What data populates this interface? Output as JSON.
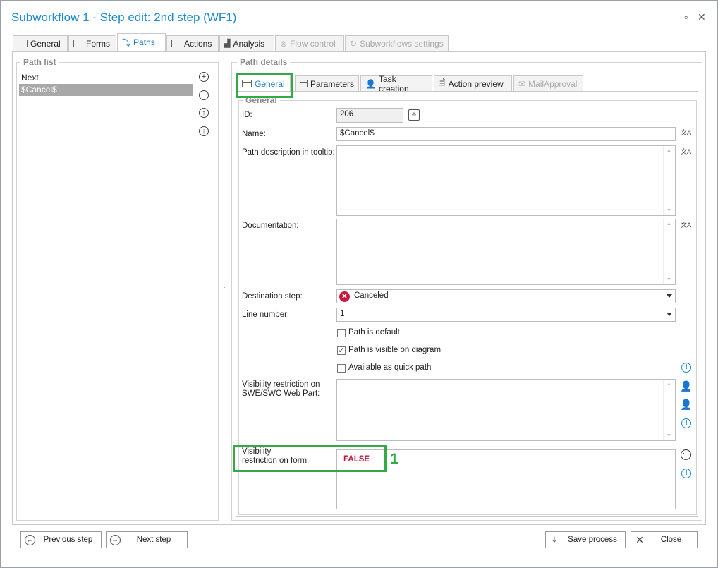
{
  "window": {
    "title": "Subworkflow 1 - Step edit: 2nd step (WF1)",
    "maximize_glyph": "▫",
    "close_glyph": "✕"
  },
  "top_tabs": [
    {
      "label": "General"
    },
    {
      "label": "Forms"
    },
    {
      "label": "Paths",
      "active": true
    },
    {
      "label": "Actions"
    },
    {
      "label": "Analysis"
    },
    {
      "label": "Flow control",
      "disabled": true
    },
    {
      "label": "Subworkflows settings",
      "disabled": true
    }
  ],
  "path_list": {
    "title": "Path list",
    "items": [
      "Next",
      "$Cancel$"
    ],
    "selected_index": 1
  },
  "path_details": {
    "title": "Path details",
    "tabs": [
      {
        "label": "General",
        "active": true
      },
      {
        "label": "Parameters"
      },
      {
        "label": "Task creation"
      },
      {
        "label": "Action preview"
      },
      {
        "label": "MailApproval",
        "disabled": true
      }
    ],
    "group_title": "General",
    "id_label": "ID:",
    "id_value": "206",
    "name_label": "Name:",
    "name_value": "$Cancel$",
    "tooltip_label": "Path description in tooltip:",
    "documentation_label": "Documentation:",
    "destination_label": "Destination step:",
    "destination_value": "Canceled",
    "line_number_label": "Line number:",
    "line_number_value": "1",
    "checkboxes": [
      {
        "label": "Path is default",
        "checked": false
      },
      {
        "label": "Path is visible on diagram",
        "checked": true
      },
      {
        "label": "Available as quick path",
        "checked": false
      }
    ],
    "visibility_webpart_label_1": "Visibility restriction on",
    "visibility_webpart_label_2": "SWE/SWC Web Part:",
    "visibility_form_label_1": "Visibility",
    "visibility_form_label_2": "restriction on form:",
    "visibility_form_value": "FALSE"
  },
  "annotation": {
    "marker": "1",
    "color": "#33aa44"
  },
  "footer": {
    "previous_label": "Previous step",
    "next_label": "Next step",
    "save_label": "Save process",
    "close_label": "Close"
  },
  "colors": {
    "title": "#1b8ccf",
    "false_value": "#c0143c",
    "info": "#1a8ad4",
    "selection": "#a8a8a8"
  }
}
